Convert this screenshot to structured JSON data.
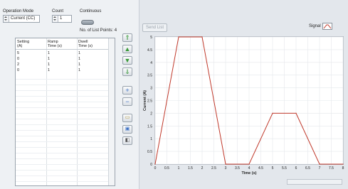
{
  "controls": {
    "operation_mode_label": "Operation Mode",
    "operation_mode_value": "Current (CC)",
    "count_label": "Count",
    "count_value": "1",
    "continuous_label": "Continuous",
    "list_points_label": "No. of List Points: 4"
  },
  "table": {
    "headers": [
      [
        "Setting",
        "(A)"
      ],
      [
        "Ramp",
        "Time (s)"
      ],
      [
        "Dwell",
        "Time (s)"
      ]
    ],
    "rows": [
      [
        "5",
        "1",
        "1"
      ],
      [
        "0",
        "1",
        "1"
      ],
      [
        "2",
        "1",
        "1"
      ],
      [
        "0",
        "1",
        "1"
      ]
    ]
  },
  "toolbar": {
    "move_top_icon": "double-up-arrow-icon",
    "move_up_icon": "up-arrow-icon",
    "move_down_icon": "down-arrow-icon",
    "move_bottom_icon": "double-down-arrow-icon",
    "add_icon": "plus-icon",
    "remove_icon": "minus-icon",
    "new_icon": "new-file-icon",
    "save_icon": "save-icon",
    "open_icon": "open-icon"
  },
  "send_list_label": "Send List",
  "legend": {
    "label": "Signal",
    "color": "#c0392b"
  },
  "chart_data": {
    "type": "line",
    "title": "",
    "xlabel": "Time (s)",
    "ylabel": "Current (A)",
    "xlim": [
      0,
      8
    ],
    "ylim": [
      0,
      5
    ],
    "xticks": [
      "0",
      "0.5",
      "1",
      "1.5",
      "2",
      "2.5",
      "3",
      "3.5",
      "4",
      "4.5",
      "5",
      "5.5",
      "6",
      "6.5",
      "7",
      "7.5",
      "8"
    ],
    "yticks": [
      "0",
      "0.5",
      "1",
      "1.5",
      "2",
      "2.5",
      "3",
      "3.5",
      "4",
      "4.5",
      "5"
    ],
    "grid": true,
    "series": [
      {
        "name": "Signal",
        "color": "#c0392b",
        "x": [
          0,
          1,
          2,
          3,
          4,
          5,
          6,
          7,
          8
        ],
        "y": [
          0,
          5,
          5,
          0,
          0,
          2,
          2,
          0,
          0
        ]
      }
    ]
  }
}
